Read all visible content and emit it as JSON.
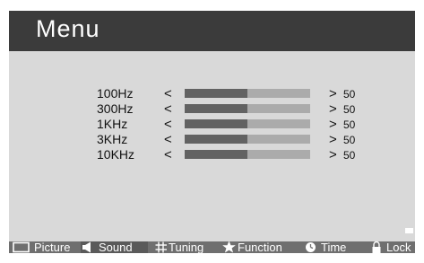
{
  "header": {
    "title": "Menu"
  },
  "equalizer": {
    "bands": [
      {
        "label": "100Hz",
        "value": "50",
        "level": 0.5
      },
      {
        "label": "300Hz",
        "value": "50",
        "level": 0.5
      },
      {
        "label": "1KHz",
        "value": "50",
        "level": 0.5
      },
      {
        "label": "3KHz",
        "value": "50",
        "level": 0.5
      },
      {
        "label": "10KHz",
        "value": "50",
        "level": 0.5
      }
    ],
    "decrease_glyph": "<",
    "increase_glyph": ">"
  },
  "tabs": [
    {
      "label": "Picture",
      "icon": "picture-icon"
    },
    {
      "label": "Sound",
      "icon": "speaker-icon",
      "active": true
    },
    {
      "label": "Tuning",
      "icon": "grid-icon"
    },
    {
      "label": "Function",
      "icon": "star-icon"
    },
    {
      "label": "Time",
      "icon": "clock-icon"
    },
    {
      "label": "Lock",
      "icon": "lock-icon"
    }
  ],
  "colors": {
    "background": "#d9d9d9",
    "titlebar": "#3b3b3b",
    "tabbar": "#6f6f6f",
    "bar_fill": "#626262",
    "bar_track": "#ababab"
  }
}
